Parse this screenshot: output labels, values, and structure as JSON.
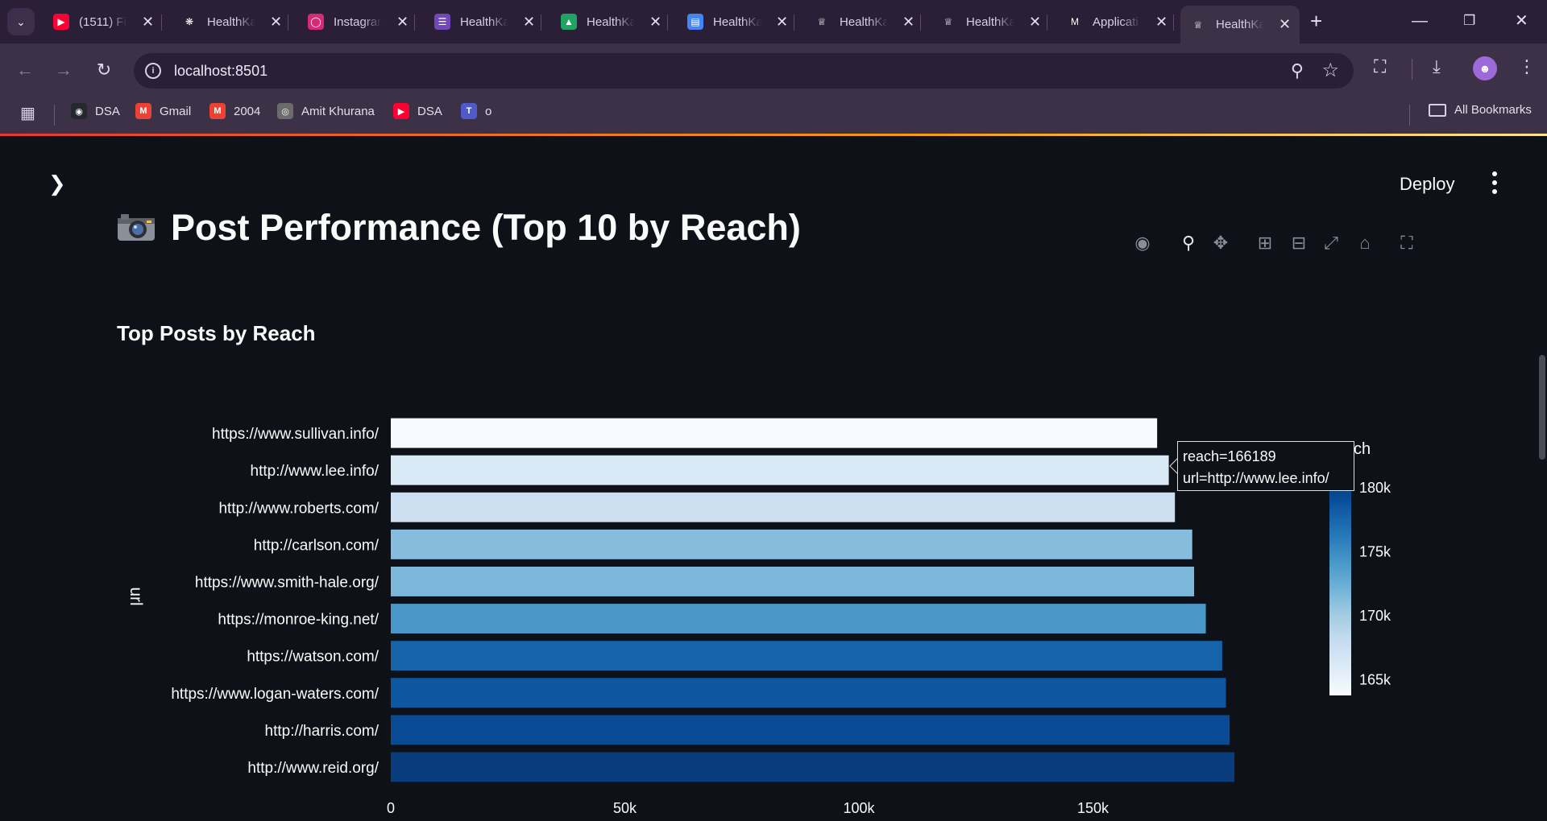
{
  "browser": {
    "tabs": [
      {
        "title": "(1511) Fi",
        "icon": "youtube-icon",
        "color": "#ff0033"
      },
      {
        "title": "HealthKa",
        "icon": "chatgpt-icon",
        "color": "#2b1f38"
      },
      {
        "title": "Instagram",
        "icon": "instagram-icon",
        "color": "#d62976"
      },
      {
        "title": "HealthKa",
        "icon": "forms-icon",
        "color": "#7248b9"
      },
      {
        "title": "HealthKa",
        "icon": "drive-icon",
        "color": "#1fa463"
      },
      {
        "title": "HealthKa",
        "icon": "docs-icon",
        "color": "#4285f4"
      },
      {
        "title": "HealthKa",
        "icon": "streamlit-crown-icon",
        "color": "#2b1f38"
      },
      {
        "title": "HealthKa",
        "icon": "streamlit-crown-icon",
        "color": "#2b1f38"
      },
      {
        "title": "Applicati",
        "icon": "gmail-icon",
        "color": "#2b1f38"
      },
      {
        "title": "HealthKa",
        "icon": "streamlit-crown-icon",
        "color": "#3c3147"
      }
    ],
    "url": "localhost:8501",
    "bookmarks": [
      {
        "label": "DSA",
        "icon": "github-icon"
      },
      {
        "label": "Gmail",
        "icon": "gmail-icon"
      },
      {
        "label": "2004",
        "icon": "gmail-icon"
      },
      {
        "label": "Amit Khurana",
        "icon": "globe-icon"
      },
      {
        "label": "DSA",
        "icon": "youtube-icon"
      },
      {
        "label": "o",
        "icon": "teams-icon"
      }
    ],
    "all_bookmarks": "All Bookmarks"
  },
  "app": {
    "deploy_label": "Deploy",
    "page_title": "Post Performance (Top 10 by Reach)",
    "title_icon": "camera-icon",
    "chart_title": "Top Posts by Reach"
  },
  "tooltip": {
    "line1": "reach=166189",
    "line2": "url=http://www.lee.info/"
  },
  "chart_data": {
    "type": "bar",
    "orientation": "horizontal",
    "title": "Top Posts by Reach",
    "xlabel": "",
    "ylabel": "url",
    "categories": [
      "https://www.sullivan.info/",
      "http://www.lee.info/",
      "http://www.roberts.com/",
      "http://carlson.com/",
      "https://www.smith-hale.org/",
      "https://monroe-king.net/",
      "https://watson.com/",
      "https://www.logan-waters.com/",
      "http://harris.com/",
      "http://www.reid.org/"
    ],
    "values": [
      163700,
      166189,
      167500,
      171200,
      171600,
      174100,
      177600,
      178400,
      179200,
      180200
    ],
    "xlim": [
      0,
      180200
    ],
    "xticks": [
      {
        "value": 0,
        "label": "0"
      },
      {
        "value": 50000,
        "label": "50k"
      },
      {
        "value": 100000,
        "label": "100k"
      },
      {
        "value": 150000,
        "label": "150k"
      }
    ],
    "colorscale": "Blues",
    "colorbar": {
      "title_visible": "ch",
      "range": [
        163700,
        181000
      ],
      "ticks": [
        {
          "value": 165000,
          "label": "165k"
        },
        {
          "value": 170000,
          "label": "170k"
        },
        {
          "value": 175000,
          "label": "175k"
        },
        {
          "value": 180000,
          "label": "180k"
        }
      ]
    },
    "grid": false,
    "legend": "colorbar-right"
  }
}
